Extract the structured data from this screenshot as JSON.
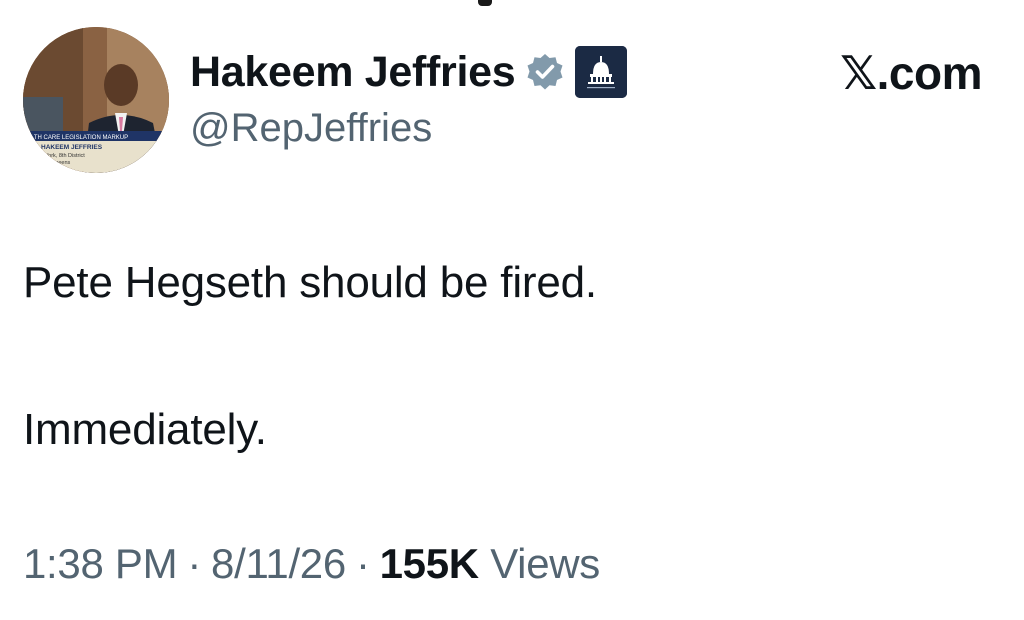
{
  "author": {
    "display_name": "Hakeem Jeffries",
    "handle": "@RepJeffries",
    "verified_icon": "verified-badge-icon",
    "affiliation_icon": "capitol-dome-icon",
    "avatar_caption": {
      "line1": "ALTH CARE LEGISLATION MARKUP",
      "line2": "HAKEEM JEFFRIES",
      "line3": "York, 8th District",
      "line4": "Queens"
    }
  },
  "source_label": "𝕏.com",
  "tweet": {
    "line1": "Pete Hegseth should be fired.",
    "line2": "Immediately."
  },
  "meta": {
    "time": "1:38 PM",
    "date": "8/11/26",
    "separator": "·",
    "views_count": "155K",
    "views_label": "Views"
  },
  "colors": {
    "text_primary": "#0f1419",
    "text_secondary": "#536471",
    "verified": "#829aab",
    "affiliate_bg": "#1b2a44"
  }
}
